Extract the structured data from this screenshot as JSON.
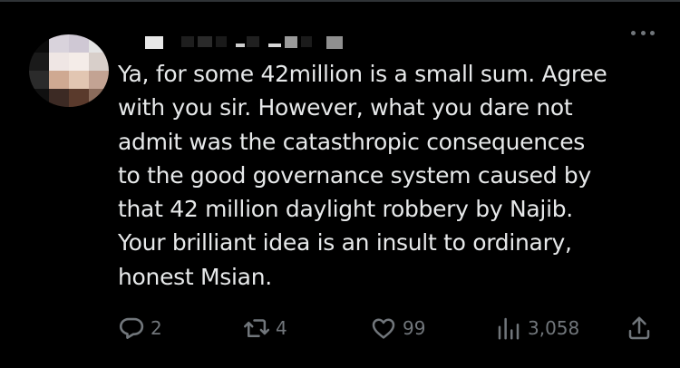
{
  "tweet": {
    "text": "Ya, for some 42million is a small sum. Agree\nwith you sir. However, what you dare not\nadmit was the catasthropic consequences\nto the good governance system caused by\nthat 42 million daylight robbery by Najib.\nYour brilliant idea is an insult to ordinary,\nhonest Msian."
  },
  "actions": {
    "reply_count": "2",
    "retweet_count": "4",
    "like_count": "99",
    "views_count": "3,058"
  },
  "icons": {
    "more": "more-horizontal-icon",
    "reply": "reply-bubble-icon",
    "retweet": "retweet-arrows-icon",
    "like": "heart-icon",
    "views": "bar-chart-icon",
    "share": "share-upload-icon"
  },
  "colors": {
    "background": "#000000",
    "text": "#e7e9ea",
    "muted": "#71767b"
  }
}
